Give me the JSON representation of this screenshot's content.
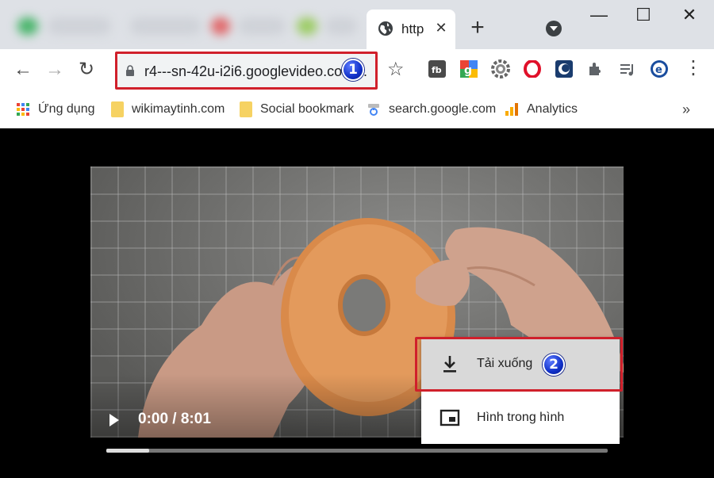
{
  "tab": {
    "title": "http",
    "close": "✕"
  },
  "tabbar": {
    "new_tab": "+",
    "min": "—",
    "max": "☐",
    "close": "✕"
  },
  "toolbar": {
    "back": "←",
    "forward": "→",
    "reload": "↻",
    "url": "r4---sn-42u-i2i6.googlevideo.com",
    "url_ellipsis": "...",
    "star": "☆",
    "menu": "⋮"
  },
  "annotations": {
    "badge_1": "1",
    "badge_2": "2"
  },
  "bookmarks": {
    "items": [
      {
        "label": "Ứng dụng",
        "icon": "apps-grid-icon"
      },
      {
        "label": "wikimaytinh.com",
        "icon": "folder-icon"
      },
      {
        "label": "Social bookmark",
        "icon": "folder-icon"
      },
      {
        "label": "search.google.com",
        "icon": "search-console-icon"
      },
      {
        "label": "Analytics",
        "icon": "analytics-icon"
      }
    ],
    "more": "»"
  },
  "video": {
    "time": "0:00 / 8:01",
    "progress": 0.085
  },
  "context_menu": {
    "items": [
      {
        "label": "Tải xuống",
        "icon": "download-icon"
      },
      {
        "label": "Hình trong hình",
        "icon": "picture-in-picture-icon"
      }
    ]
  },
  "colors": {
    "highlight": "#d0202b",
    "badge": "#1030c8",
    "tabbar": "#dee1e6"
  }
}
